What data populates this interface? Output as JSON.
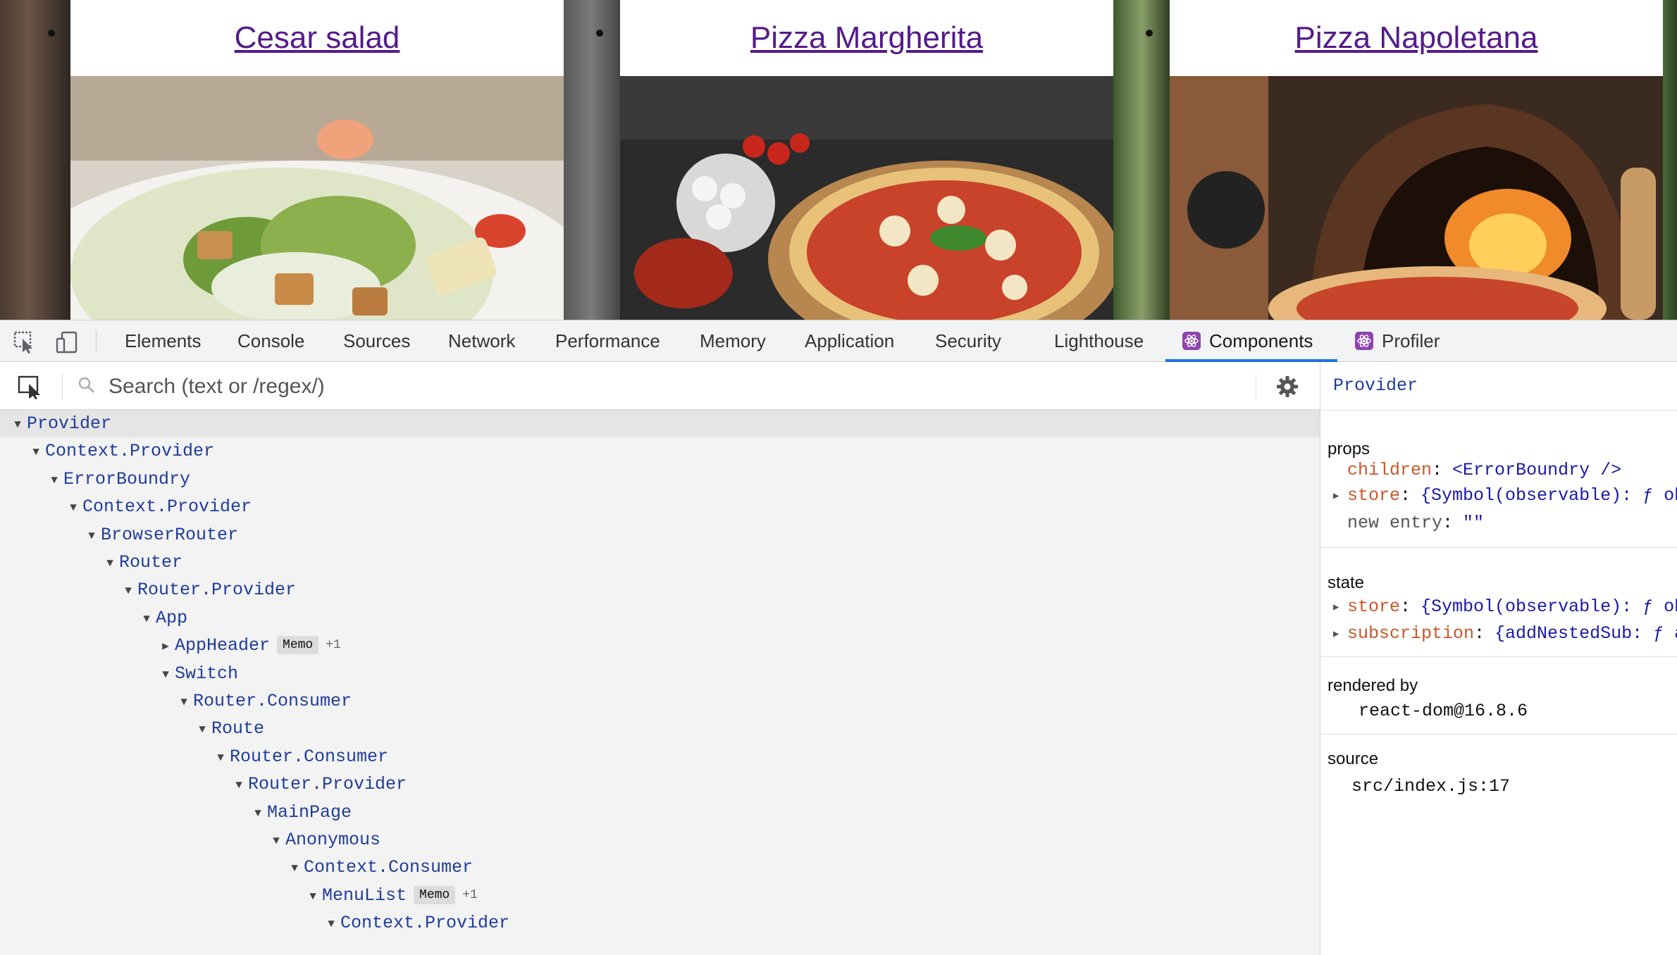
{
  "website": {
    "cards": [
      {
        "title": "Cesar salad"
      },
      {
        "title": "Pizza Margherita"
      },
      {
        "title": "Pizza Napoletana"
      }
    ]
  },
  "devtools": {
    "tabs": [
      {
        "label": "Elements"
      },
      {
        "label": "Console"
      },
      {
        "label": "Sources"
      },
      {
        "label": "Network"
      },
      {
        "label": "Performance"
      },
      {
        "label": "Memory"
      },
      {
        "label": "Application"
      },
      {
        "label": "Security"
      },
      {
        "label": "Lighthouse"
      },
      {
        "label": "Components",
        "active": true,
        "icon": "react-icon"
      },
      {
        "label": "Profiler",
        "icon": "react-icon"
      }
    ],
    "components": {
      "search_placeholder": "Search (text or /regex/)",
      "tree": [
        {
          "name": "Provider",
          "depth": 0,
          "expanded": true,
          "selected": true
        },
        {
          "name": "Context.Provider",
          "depth": 1,
          "expanded": true
        },
        {
          "name": "ErrorBoundry",
          "depth": 2,
          "expanded": true
        },
        {
          "name": "Context.Provider",
          "depth": 3,
          "expanded": true
        },
        {
          "name": "BrowserRouter",
          "depth": 4,
          "expanded": true
        },
        {
          "name": "Router",
          "depth": 5,
          "expanded": true
        },
        {
          "name": "Router.Provider",
          "depth": 6,
          "expanded": true
        },
        {
          "name": "App",
          "depth": 7,
          "expanded": true
        },
        {
          "name": "AppHeader",
          "depth": 8,
          "expanded": false,
          "badge": "Memo",
          "extra": "+1"
        },
        {
          "name": "Switch",
          "depth": 8,
          "expanded": true
        },
        {
          "name": "Router.Consumer",
          "depth": 9,
          "expanded": true
        },
        {
          "name": "Route",
          "depth": 10,
          "expanded": true
        },
        {
          "name": "Router.Consumer",
          "depth": 11,
          "expanded": true
        },
        {
          "name": "Router.Provider",
          "depth": 12,
          "expanded": true
        },
        {
          "name": "MainPage",
          "depth": 13,
          "expanded": true
        },
        {
          "name": "Anonymous",
          "depth": 14,
          "expanded": true
        },
        {
          "name": "Context.Consumer",
          "depth": 15,
          "expanded": true
        },
        {
          "name": "MenuList",
          "depth": 16,
          "expanded": true,
          "badge": "Memo",
          "extra": "+1"
        },
        {
          "name": "Context.Provider",
          "depth": 17,
          "expanded": true
        }
      ]
    },
    "side": {
      "title": "Provider",
      "props_label": "props",
      "props": [
        {
          "key": "children",
          "value": "<ErrorBoundry />",
          "expandable": false
        },
        {
          "key": "store",
          "value": "{Symbol(observable): ƒ ob",
          "expandable": true
        },
        {
          "key": "new entry",
          "value": "\"\"",
          "expandable": false,
          "placeholder": true
        }
      ],
      "state_label": "state",
      "state": [
        {
          "key": "store",
          "value": "{Symbol(observable): ƒ ob",
          "expandable": true
        },
        {
          "key": "subscription",
          "value": "{addNestedSub: ƒ a",
          "expandable": true
        }
      ],
      "rendered_by_label": "rendered by",
      "rendered_by": "react-dom@16.8.6",
      "source_label": "source",
      "source": "src/index.js:17"
    }
  }
}
